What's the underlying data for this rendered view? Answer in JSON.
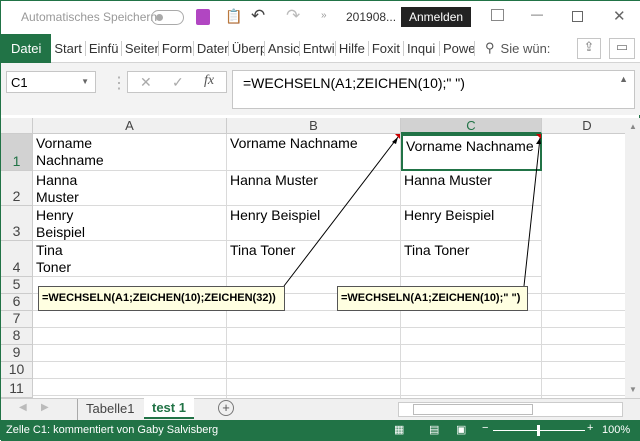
{
  "titlebar": {
    "autosave": "Automatisches Speichern",
    "filename": "201908...",
    "signin": "Anmelden"
  },
  "ribbon": {
    "tabs": [
      "Datei",
      "Start",
      "Einfü",
      "Seiter",
      "Form",
      "Dater",
      "Überp",
      "Ansic",
      "Entwi",
      "Hilfe",
      "Foxit",
      "Inqui",
      "Powe"
    ],
    "search": "Sie wün:"
  },
  "formula": {
    "namebox": "C1",
    "fx": "fx",
    "value": "=WECHSELN(A1;ZEICHEN(10);\" \")"
  },
  "columns": [
    "A",
    "B",
    "C",
    "D"
  ],
  "rows": [
    "1",
    "2",
    "3",
    "4",
    "5",
    "6",
    "7",
    "8",
    "9",
    "10",
    "11"
  ],
  "cells": {
    "A1": "Vorname\nNachname",
    "B1": "Vorname Nachname",
    "C1": "Vorname Nachname",
    "A2": "Hanna\nMuster",
    "B2": "Hanna Muster",
    "C2": "Hanna Muster",
    "A3": "Henry\nBeispiel",
    "B3": "Henry Beispiel",
    "C3": "Henry Beispiel",
    "A4": "Tina\nToner",
    "B4": "Tina Toner",
    "C4": "Tina Toner"
  },
  "comments": [
    "=WECHSELN(A1;ZEICHEN(10);ZEICHEN(32))",
    "=WECHSELN(A1;ZEICHEN(10);\" \")"
  ],
  "sheets": [
    "Tabelle1",
    "test 1"
  ],
  "status": {
    "text": "Zelle C1: kommentiert von Gaby Salvisberg",
    "zoom": "100%"
  },
  "colors": {
    "accent": "#217346",
    "note": "#ffffe1"
  }
}
